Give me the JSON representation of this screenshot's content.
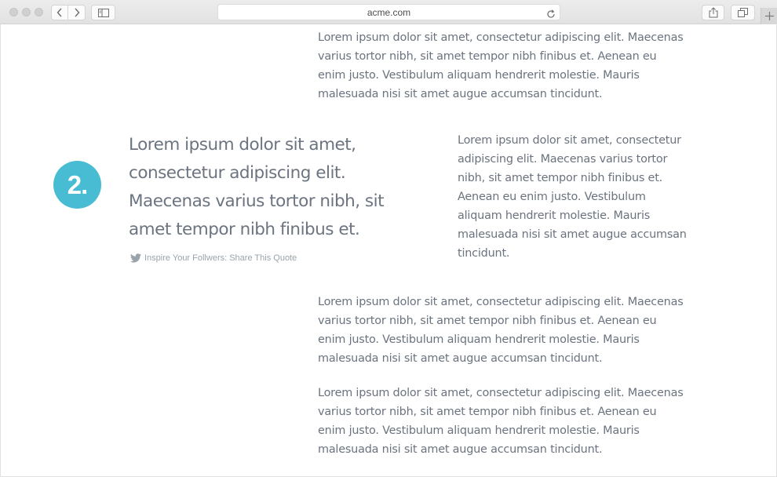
{
  "browser": {
    "url": "acme.com",
    "icons": {
      "back": "chevron-left-icon",
      "forward": "chevron-right-icon",
      "sidebar": "sidebar-icon",
      "reload": "reload-icon",
      "share": "share-icon",
      "tabs": "tabs-icon",
      "new_tab": "plus-icon"
    }
  },
  "content": {
    "paragraph_1": "Lorem ipsum dolor sit amet, consectetur adipiscing elit. Maecenas varius tortor nibh, sit amet tempor nibh finibus et. Aenean eu enim justo. Vestibulum aliquam hendrerit molestie. Mauris malesuada nisi sit amet augue accumsan tincidunt.",
    "step_number": "2.",
    "pull_quote": "Lorem ipsum dolor sit amet, consectetur adipiscing elit. Maecenas varius tortor nibh, sit amet tempor nibh finibus et.",
    "share_link": "Inspire Your Follwers: Share This Quote",
    "side_paragraph": "Lorem ipsum dolor sit amet, consectetur adipiscing elit. Maecenas varius tortor nibh, sit amet tempor nibh finibus et. Aenean eu enim justo. Vestibulum aliquam hendrerit molestie. Mauris malesuada nisi sit amet augue accumsan tincidunt.",
    "paragraph_3": "Lorem ipsum dolor sit amet, consectetur adipiscing elit. Maecenas varius tortor nibh, sit amet tempor nibh finibus et. Aenean eu enim justo. Vestibulum aliquam hendrerit molestie. Mauris malesuada nisi sit amet augue accumsan tincidunt.",
    "paragraph_4": "Lorem ipsum dolor sit amet, consectetur adipiscing elit. Maecenas varius tortor nibh, sit amet tempor nibh finibus et. Aenean eu enim justo. Vestibulum aliquam hendrerit molestie. Mauris malesuada nisi sit amet augue accumsan tincidunt."
  },
  "colors": {
    "badge": "#47bcd2",
    "body_text": "#6a737f",
    "muted_text": "#9aa3ab"
  }
}
